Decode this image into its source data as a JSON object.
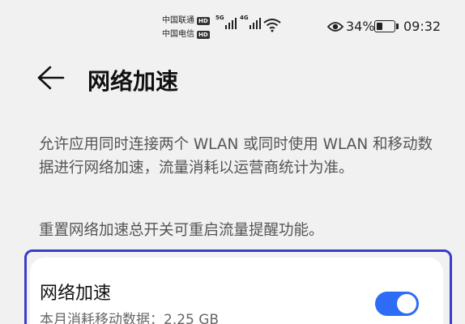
{
  "status_bar": {
    "carrier_1": "中国联通",
    "carrier_2": "中国电信",
    "hd_label": "HD",
    "sim1_network": "5G",
    "sim2_network": "4G",
    "battery_percent": "34%",
    "battery_level": 0.34,
    "time": "09:32",
    "icons": [
      "signal-icon",
      "wifi-icon",
      "eye-icon",
      "battery-icon"
    ]
  },
  "header": {
    "title": "网络加速",
    "back_icon": "arrow-left-icon"
  },
  "description": {
    "text": "允许应用同时连接两个 WLAN 或同时使用 WLAN 和移动数据进行网络加速，流量消耗以运营商统计为准。",
    "hint": "重置网络加速总开关可重启流量提醒功能。"
  },
  "setting_card": {
    "title": "网络加速",
    "subtitle": "本月消耗移动数据：2.25 GB",
    "toggle_on": true
  },
  "colors": {
    "background": "#f1f1f1",
    "accent": "#2d6cf6",
    "focus_outline": "#3a3cc8"
  }
}
